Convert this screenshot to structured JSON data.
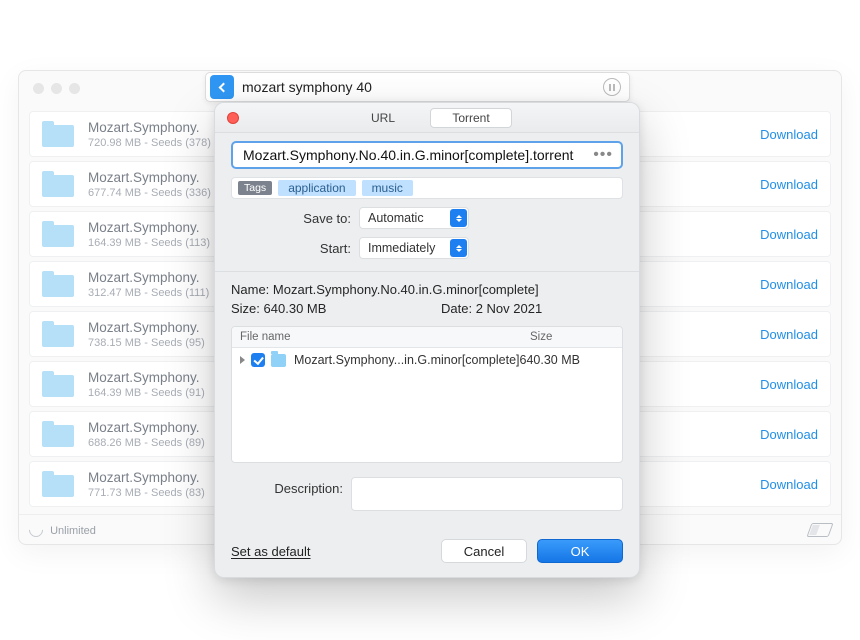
{
  "search": {
    "query": "mozart symphony 40"
  },
  "results": [
    {
      "title": "Mozart.Symphony.",
      "size": "720.98 MB",
      "seeds": "378"
    },
    {
      "title": "Mozart.Symphony.",
      "size": "677.74 MB",
      "seeds": "336"
    },
    {
      "title": "Mozart.Symphony.",
      "size": "164.39 MB",
      "seeds": "113"
    },
    {
      "title": "Mozart.Symphony.",
      "size": "312.47 MB",
      "seeds": "111"
    },
    {
      "title": "Mozart.Symphony.",
      "size": "738.15 MB",
      "seeds": "95"
    },
    {
      "title": "Mozart.Symphony.",
      "size": "164.39 MB",
      "seeds": "91"
    },
    {
      "title": "Mozart.Symphony.",
      "size": "688.26 MB",
      "seeds": "89"
    },
    {
      "title": "Mozart.Symphony.",
      "size": "771.73 MB",
      "seeds": "83"
    }
  ],
  "row_download_label": "Download",
  "footer": {
    "status": "Unlimited"
  },
  "modal": {
    "tabs": {
      "url": "URL",
      "torrent": "Torrent"
    },
    "filename": "Mozart.Symphony.No.40.in.G.minor[complete].torrent",
    "tags_label": "Tags",
    "tags": [
      "application",
      "music"
    ],
    "save_to_label": "Save to:",
    "save_to_value": "Automatic",
    "start_label": "Start:",
    "start_value": "Immediately",
    "name_label": "Name:",
    "name_value": "Mozart.Symphony.No.40.in.G.minor[complete]",
    "size_label": "Size:",
    "size_value": "640.30 MB",
    "date_label": "Date:",
    "date_value": "2 Nov 2021",
    "cols": {
      "file": "File name",
      "size": "Size"
    },
    "file_row": {
      "name": "Mozart.Symphony...in.G.minor[complete]",
      "size": "640.30 MB"
    },
    "desc_label": "Description:",
    "set_default": "Set as default",
    "cancel": "Cancel",
    "ok": "OK"
  }
}
